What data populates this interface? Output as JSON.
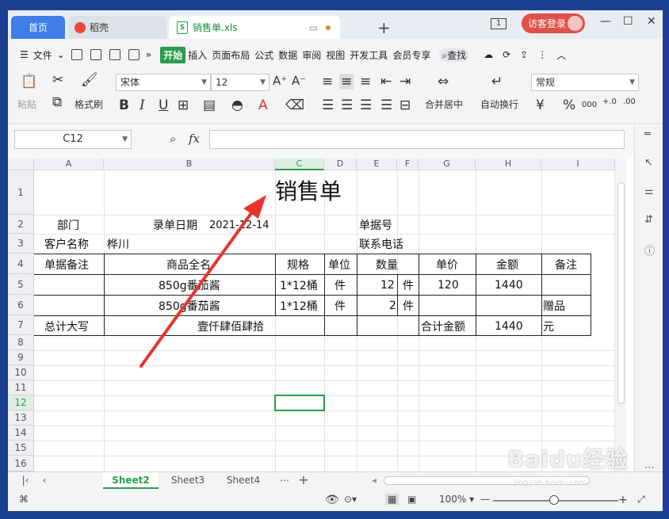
{
  "titlebar": {
    "home_tab": "首页",
    "doc_tab": "稻壳",
    "file_tab": "销售单.xls",
    "login_label": "访客登录",
    "num_badge": "1"
  },
  "menu": {
    "file": "文件",
    "items": [
      "开始",
      "插入",
      "页面布局",
      "公式",
      "数据",
      "审阅",
      "视图",
      "开发工具",
      "会员专享"
    ],
    "search": "查找"
  },
  "ribbon": {
    "paste": "粘贴",
    "format_painter": "格式刷",
    "font_name": "宋体",
    "font_size": "12",
    "merge_center": "合并居中",
    "wrap_text": "自动换行",
    "number_format": "常规",
    "currency_sym": "¥",
    "percent_sym": "%",
    "thousands_sym": "000",
    "bold": "B",
    "italic": "I",
    "underline": "U"
  },
  "formula_bar": {
    "name_box": "C12",
    "fx": "fx",
    "content": ""
  },
  "columns": [
    "A",
    "B",
    "C",
    "D",
    "E",
    "F",
    "G",
    "H",
    "I"
  ],
  "rows": [
    "1",
    "2",
    "3",
    "4",
    "5",
    "6",
    "7",
    "8",
    "9",
    "10",
    "11",
    "12",
    "13",
    "14",
    "15",
    "16"
  ],
  "sheet": {
    "title": "销售单",
    "r2": {
      "a": "部门",
      "b": "录单日期",
      "b_date": "2021-12-14",
      "e": "单据号"
    },
    "r3": {
      "a": "客户名称",
      "b": "桦川",
      "e": "联系电话"
    },
    "r4": {
      "a": "单据备注",
      "b": "商品全名",
      "c": "规格",
      "d": "单位",
      "e": "数量",
      "g": "单价",
      "h": "金额",
      "i": "备注"
    },
    "r5": {
      "b": "850g番茄酱",
      "c": "1*12桶",
      "d": "件",
      "e": "12",
      "f": "件",
      "g": "120",
      "h": "1440",
      "i": ""
    },
    "r6": {
      "b": "850g番茄酱",
      "c": "1*12桶",
      "d": "件",
      "e": "2",
      "f": "件",
      "g": "",
      "h": "",
      "i": "赠品"
    },
    "r7": {
      "a": "总计大写",
      "b": "壹仟肆佰肆拾",
      "g": "合计金额",
      "h": "1440",
      "i": "元"
    }
  },
  "sheet_tabs": [
    "Sheet2",
    "Sheet3",
    "Sheet4"
  ],
  "active_sheet": "Sheet2",
  "status": {
    "zoom": "100%"
  },
  "colors": {
    "accent": "#2a9d4d",
    "home_tab": "#3f7ee8",
    "login": "#e0504a",
    "arrow": "#e8342c"
  },
  "watermark": {
    "main": "Baidu经验",
    "sub": "jingyan.baidu.com"
  }
}
